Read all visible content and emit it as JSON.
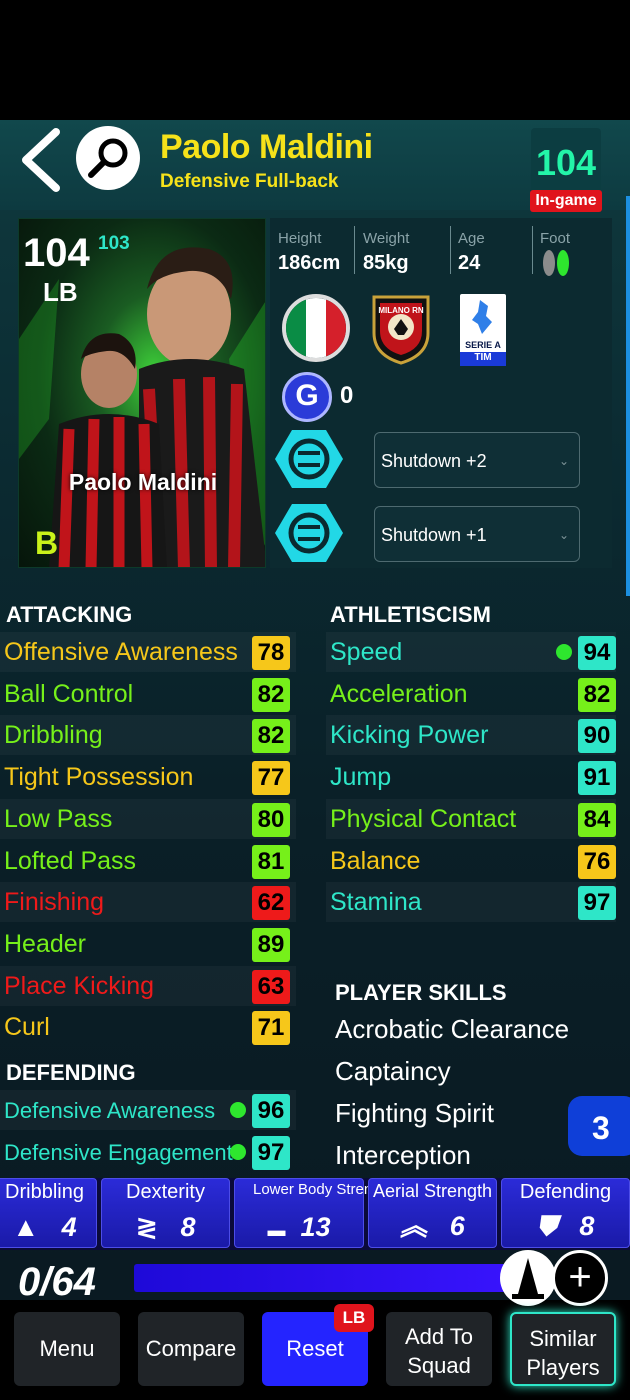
{
  "header": {
    "player_name": "Paolo Maldini",
    "player_role": "Defensive Full-back",
    "overall": "104",
    "overall_badge": "In-game"
  },
  "card": {
    "overall": "104",
    "overall_alt": "103",
    "position": "LB",
    "name": "Paolo Maldini",
    "grade": "B"
  },
  "info": {
    "height_label": "Height",
    "height": "186cm",
    "weight_label": "Weight",
    "weight": "85kg",
    "age_label": "Age",
    "age": "24",
    "foot_label": "Foot",
    "club_name": "MILANO RN",
    "league_name": "SERIE A",
    "league_sponsor": "TIM",
    "gcoin_value": "0"
  },
  "progression": [
    {
      "label": "Shutdown +2"
    },
    {
      "label": "Shutdown +1"
    }
  ],
  "attacking": {
    "title": "ATTACKING",
    "stats": [
      {
        "label": "Offensive Awareness",
        "value": "78",
        "color": "#f6c71a"
      },
      {
        "label": "Ball Control",
        "value": "82",
        "color": "#76f01a"
      },
      {
        "label": "Dribbling",
        "value": "82",
        "color": "#76f01a"
      },
      {
        "label": "Tight Possession",
        "value": "77",
        "color": "#f6c71a"
      },
      {
        "label": "Low Pass",
        "value": "80",
        "color": "#76f01a"
      },
      {
        "label": "Lofted Pass",
        "value": "81",
        "color": "#76f01a"
      },
      {
        "label": "Finishing",
        "value": "62",
        "color": "#ee1a1a"
      },
      {
        "label": "Header",
        "value": "89",
        "color": "#76f01a"
      },
      {
        "label": "Place Kicking",
        "value": "63",
        "color": "#ee1a1a"
      },
      {
        "label": "Curl",
        "value": "71",
        "color": "#f6c71a"
      }
    ]
  },
  "defending": {
    "title": "DEFENDING",
    "stats": [
      {
        "label": "Defensive Awareness",
        "value": "96",
        "color": "#2ee6c8"
      },
      {
        "label": "Defensive Engagement",
        "value": "97",
        "color": "#2ee6c8"
      }
    ]
  },
  "athleticism": {
    "title": "ATHLETISCISM",
    "stats": [
      {
        "label": "Speed",
        "value": "94",
        "color": "#2ee6c8"
      },
      {
        "label": "Acceleration",
        "value": "82",
        "color": "#76f01a"
      },
      {
        "label": "Kicking Power",
        "value": "90",
        "color": "#2ee6c8"
      },
      {
        "label": "Jump",
        "value": "91",
        "color": "#2ee6c8"
      },
      {
        "label": "Physical Contact",
        "value": "84",
        "color": "#76f01a"
      },
      {
        "label": "Balance",
        "value": "76",
        "color": "#f6c71a"
      },
      {
        "label": "Stamina",
        "value": "97",
        "color": "#2ee6c8"
      }
    ]
  },
  "player_skills": {
    "title": "PLAYER SKILLS",
    "items": [
      "Acrobatic Clearance",
      "Captaincy",
      "Fighting Spirit",
      "Interception"
    ],
    "more_count": "3"
  },
  "categories": [
    {
      "label": "Dribbling",
      "value": "4",
      "icon": "cone-icon"
    },
    {
      "label": "Dexterity",
      "value": "8",
      "icon": "zigzag-icon"
    },
    {
      "label": "Lower Body Strength",
      "value": "13",
      "icon": "boot-icon"
    },
    {
      "label": "Aerial Strength",
      "value": "6",
      "icon": "double-chevron-up-icon"
    },
    {
      "label": "Defending",
      "value": "8",
      "icon": "shield-icon"
    }
  ],
  "points": {
    "display": "0/64"
  },
  "bottom_nav": {
    "menu": "Menu",
    "compare": "Compare",
    "reset": "Reset",
    "reset_tag": "LB",
    "add_line1": "Add To",
    "add_line2": "Squad",
    "similar_line1": "Similar",
    "similar_line2": "Players"
  },
  "colors": {
    "name_yellow": "#f6e21a",
    "ovr_green": "#23f5a8",
    "badge_red": "#e0141c",
    "accent_blue": "#2b2bd8"
  }
}
